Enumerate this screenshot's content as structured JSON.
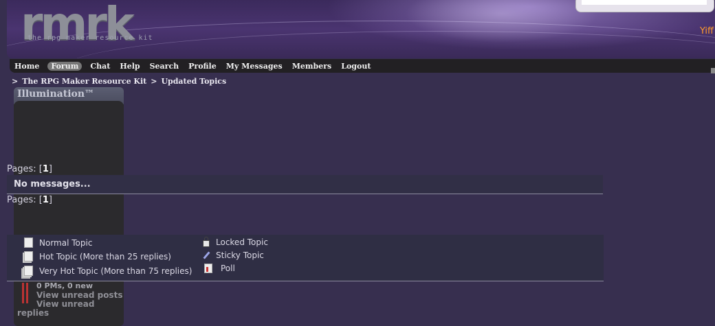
{
  "header": {
    "logo": "rmrk",
    "logo_subtitle": "the rpg maker resource kit",
    "user_text": "Yiff"
  },
  "nav": {
    "items": [
      {
        "label": "Home",
        "active": false
      },
      {
        "label": "Forum",
        "active": true
      },
      {
        "label": "Chat",
        "active": false
      },
      {
        "label": "Help",
        "active": false
      },
      {
        "label": "Search",
        "active": false
      },
      {
        "label": "Profile",
        "active": false
      },
      {
        "label": "My Messages",
        "active": false
      },
      {
        "label": "Members",
        "active": false
      },
      {
        "label": "Logout",
        "active": false
      }
    ]
  },
  "breadcrumb": {
    "items": [
      "The RPG Maker Resource Kit",
      "Updated Topics"
    ],
    "separator": ">"
  },
  "sidebox": {
    "title": "Illumination™",
    "pm_text": "0 PMs, 0 new",
    "link_unread_posts": "View unread posts",
    "link_unread_replies_1": "View unread",
    "link_unread_replies_2": "replies"
  },
  "pages": {
    "label": "Pages:",
    "current": "1"
  },
  "messages": {
    "empty_text": "No messages..."
  },
  "legend": {
    "normal": "Normal Topic",
    "hot": "Hot Topic (More than 25 replies)",
    "very_hot": "Very Hot Topic (More than 75 replies)",
    "locked": "Locked Topic",
    "sticky": "Sticky Topic",
    "poll": "Poll"
  },
  "colors": {
    "background": "#372f4f",
    "nav_background": "#222023",
    "user_text": "#ff9a2c"
  }
}
